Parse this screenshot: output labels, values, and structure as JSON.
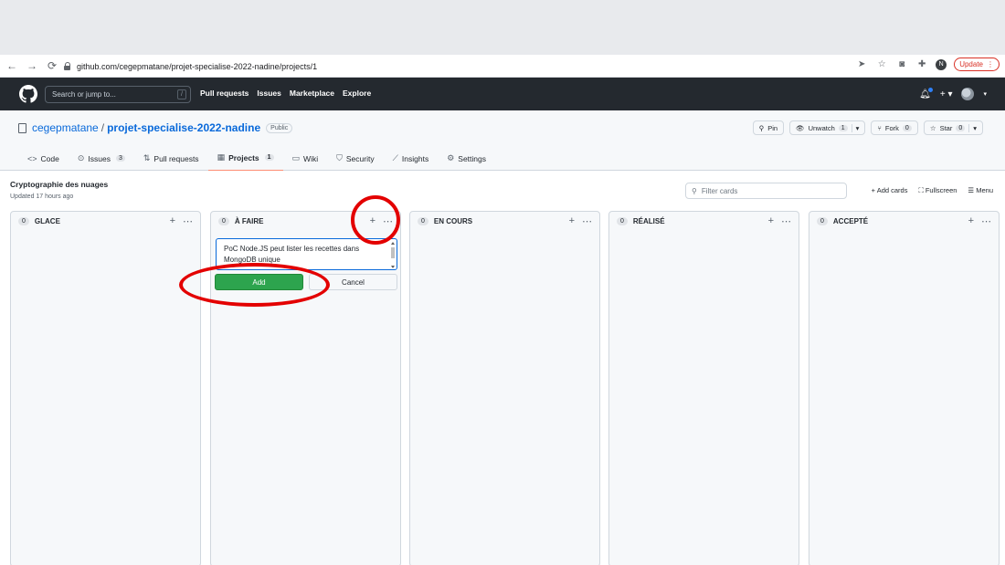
{
  "browser": {
    "url": "github.com/cegepmatane/projet-specialise-2022-nadine/projects/1",
    "update_label": "Update"
  },
  "header": {
    "search_placeholder": "Search or jump to...",
    "slash": "/",
    "nav": [
      "Pull requests",
      "Issues",
      "Marketplace",
      "Explore"
    ]
  },
  "repo": {
    "owner": "cegepmatane",
    "separator": "/",
    "name": "projet-specialise-2022-nadine",
    "visibility": "Public",
    "pin_label": "Pin",
    "unwatch_label": "Unwatch",
    "unwatch_count": "1",
    "fork_label": "Fork",
    "fork_count": "0",
    "star_label": "Star",
    "star_count": "0",
    "tabs": [
      {
        "label": "Code",
        "count": ""
      },
      {
        "label": "Issues",
        "count": "3"
      },
      {
        "label": "Pull requests",
        "count": ""
      },
      {
        "label": "Projects",
        "count": "1"
      },
      {
        "label": "Wiki",
        "count": ""
      },
      {
        "label": "Security",
        "count": ""
      },
      {
        "label": "Insights",
        "count": ""
      },
      {
        "label": "Settings",
        "count": ""
      }
    ]
  },
  "project": {
    "title": "Cryptographie des nuages",
    "updated": "Updated 17 hours ago",
    "filter_placeholder": "Filter cards",
    "add_cards": "Add cards",
    "fullscreen": "Fullscreen",
    "menu": "Menu",
    "columns": [
      {
        "name": "GLACE",
        "count": "0"
      },
      {
        "name": "À FAIRE",
        "count": "0"
      },
      {
        "name": "EN COURS",
        "count": "0"
      },
      {
        "name": "RÉALISÉ",
        "count": "0"
      },
      {
        "name": "ACCEPTÉ",
        "count": "0"
      }
    ],
    "note_text": "PoC Node.JS peut lister les recettes dans MongoDB unique",
    "add_label": "Add",
    "cancel_label": "Cancel"
  },
  "colors": {
    "header_bg": "#24292f",
    "add_green": "#2da44e",
    "annotation_red": "#e30000",
    "link_blue": "#0969da"
  }
}
